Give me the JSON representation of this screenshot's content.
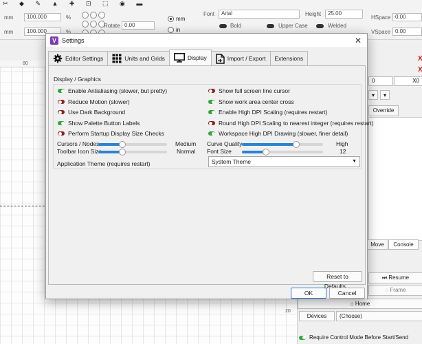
{
  "background_app": {
    "toolbar": {
      "unit_mm_1": "mm",
      "unit_mm_2": "mm",
      "field_1": "100.000",
      "field_2": "100.000",
      "percent_1": "%",
      "percent_2": "%",
      "rotate_label": "Rotate",
      "rotate_value": "0.00",
      "radio_mm": "mm",
      "radio_in": "in",
      "font_label": "Font",
      "font_value": "Arial",
      "height_label": "Height",
      "height_value": "25.00",
      "bold_label": "Bold",
      "upper_case_label": "Upper Case",
      "welded_label": "Welded",
      "hspace_label": "HSpace",
      "vspace_label": "VSpace",
      "hspace_value": "0.00",
      "vspace_value": "0.00"
    },
    "ruler": {
      "label_80": "80",
      "label_20": "20"
    },
    "right_panel": {
      "x_marks": [
        "X",
        "X"
      ],
      "x0_field_a": "0",
      "x0_field_b": "X0",
      "override_label": "Override",
      "tab_move": "Move",
      "tab_console": "Console",
      "resume_label": "Resume",
      "frame_label": "Frame",
      "home_label": "Home",
      "devices_label": "Devices",
      "devices_value": "(Choose)",
      "require_control_label": "Require Control Mode Before Start/Send"
    }
  },
  "dialog": {
    "title": "Settings",
    "close_glyph": "✕",
    "tabs": [
      {
        "label": "Editor Settings",
        "icon": "gear-icon",
        "active": false
      },
      {
        "label": "Units and Grids",
        "icon": "grid-icon",
        "active": false
      },
      {
        "label": "Display",
        "icon": "monitor-icon",
        "active": true
      },
      {
        "label": "Import / Export",
        "icon": "file-icon",
        "active": false
      },
      {
        "label": "Extensions",
        "icon": "",
        "active": false
      }
    ],
    "section_title": "Display / Graphics",
    "left_options": [
      {
        "label": "Enable Antialiasing (slower, but pretty)",
        "on": true
      },
      {
        "label": "Reduce Motion (slower)",
        "on": false
      },
      {
        "label": "Use Dark Background",
        "on": false
      },
      {
        "label": "Show Palette Button Labels",
        "on": true
      },
      {
        "label": "Perform Startup Display Size Checks",
        "on": false
      }
    ],
    "right_options": [
      {
        "label": "Show full screen line cursor",
        "on": false
      },
      {
        "label": "Show work area center cross",
        "on": true
      },
      {
        "label": "Enable High DPI Scaling (requires restart)",
        "on": true
      },
      {
        "label": "Round High DPI Scaling to nearest integer (requires restart)",
        "on": false
      },
      {
        "label": "Workspace High DPI Drawing (slower, finer detail)",
        "on": true
      }
    ],
    "sliders": {
      "cursors_nodes": {
        "label": "Cursors / Nodes",
        "value": "Medium",
        "level": 0.35
      },
      "toolbar_icon_size": {
        "label": "Toolbar Icon Size",
        "value": "Normal",
        "level": 0.35
      },
      "curve_quality": {
        "label": "Curve Quality",
        "value": "High",
        "level": 0.67
      },
      "font_size": {
        "label": "Font Size",
        "value": "12",
        "level": 0.3
      }
    },
    "theme": {
      "label": "Application Theme (requires restart)",
      "value": "System Theme"
    },
    "buttons": {
      "reset": "Reset to Defaults...",
      "ok": "OK",
      "cancel": "Cancel"
    },
    "colors": {
      "toggle_on": "#2faa3a",
      "toggle_off": "#8a1f1f",
      "slider_fill": "#2a84d2",
      "primary_border": "#2b7bd0"
    }
  }
}
